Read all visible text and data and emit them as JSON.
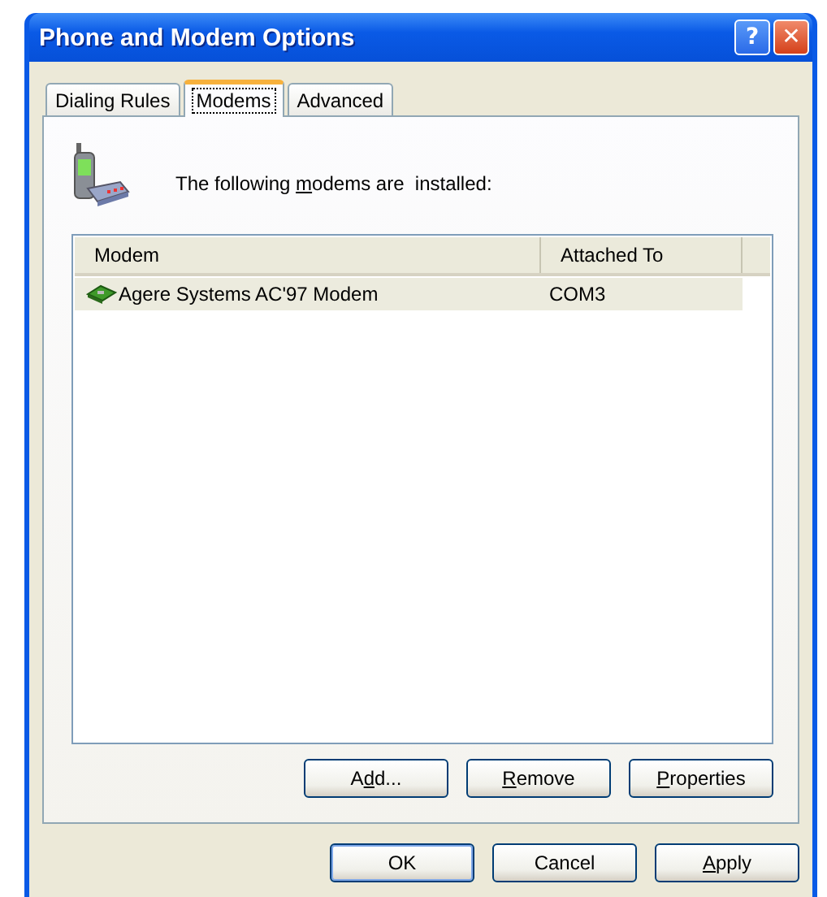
{
  "window": {
    "title": "Phone and Modem Options",
    "help_button": "?",
    "close_button": "✕"
  },
  "tabs": [
    {
      "label": "Dialing Rules",
      "selected": false
    },
    {
      "label": "Modems",
      "selected": true
    },
    {
      "label": "Advanced",
      "selected": false
    }
  ],
  "intro": {
    "pre": "The following ",
    "key": "m",
    "post": "odems are  installed:"
  },
  "table": {
    "columns": [
      "Modem",
      "Attached To"
    ],
    "rows": [
      {
        "cells": [
          "Agere Systems AC'97 Modem",
          "COM3"
        ],
        "selected": true
      }
    ]
  },
  "list_buttons": [
    {
      "pre": "A",
      "key": "d",
      "post": "d..."
    },
    {
      "key": "R",
      "post": "emove"
    },
    {
      "key": "P",
      "post": "roperties"
    }
  ],
  "dialog_buttons": [
    {
      "pre": "OK",
      "default": true
    },
    {
      "pre": "Cancel",
      "default": false
    },
    {
      "key": "A",
      "post": "pply",
      "default": false
    }
  ]
}
